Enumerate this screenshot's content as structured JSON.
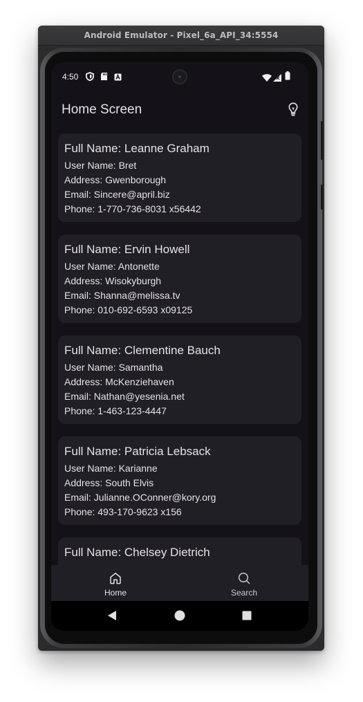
{
  "window": {
    "title": "Android Emulator - Pixel_6a_API_34:5554"
  },
  "status_bar": {
    "time": "4:50",
    "left_icons": [
      "shield-icon",
      "sd-card-icon",
      "notification-a-icon"
    ],
    "right_icons": [
      "wifi-icon",
      "signal-icon",
      "battery-icon"
    ]
  },
  "app_bar": {
    "title": "Home Screen",
    "action_icon": "lightbulb-icon"
  },
  "users": [
    {
      "full_name": "Full Name: Leanne Graham",
      "user_name": "User Name: Bret",
      "address": "Address: Gwenborough",
      "email": "Email: Sincere@april.biz",
      "phone": "Phone: 1-770-736-8031 x56442"
    },
    {
      "full_name": "Full Name: Ervin Howell",
      "user_name": "User Name: Antonette",
      "address": "Address: Wisokyburgh",
      "email": "Email: Shanna@melissa.tv",
      "phone": "Phone: 010-692-6593 x09125"
    },
    {
      "full_name": "Full Name: Clementine Bauch",
      "user_name": "User Name: Samantha",
      "address": "Address: McKenziehaven",
      "email": "Email: Nathan@yesenia.net",
      "phone": "Phone: 1-463-123-4447"
    },
    {
      "full_name": "Full Name: Patricia Lebsack",
      "user_name": "User Name: Karianne",
      "address": "Address: South Elvis",
      "email": "Email: Julianne.OConner@kory.org",
      "phone": "Phone: 493-170-9623 x156"
    },
    {
      "full_name": "Full Name: Chelsey Dietrich"
    }
  ],
  "bottom_nav": {
    "items": [
      {
        "label": "Home",
        "icon": "home-icon",
        "selected": true
      },
      {
        "label": "Search",
        "icon": "search-icon",
        "selected": false
      }
    ]
  },
  "system_nav": {
    "buttons": [
      "back-icon",
      "home-circle-icon",
      "recents-icon"
    ]
  },
  "colors": {
    "screen_background": "#141218",
    "card_background": "#211f26",
    "text_primary": "#e6e1e5",
    "nav_label": "#cac4d0"
  }
}
